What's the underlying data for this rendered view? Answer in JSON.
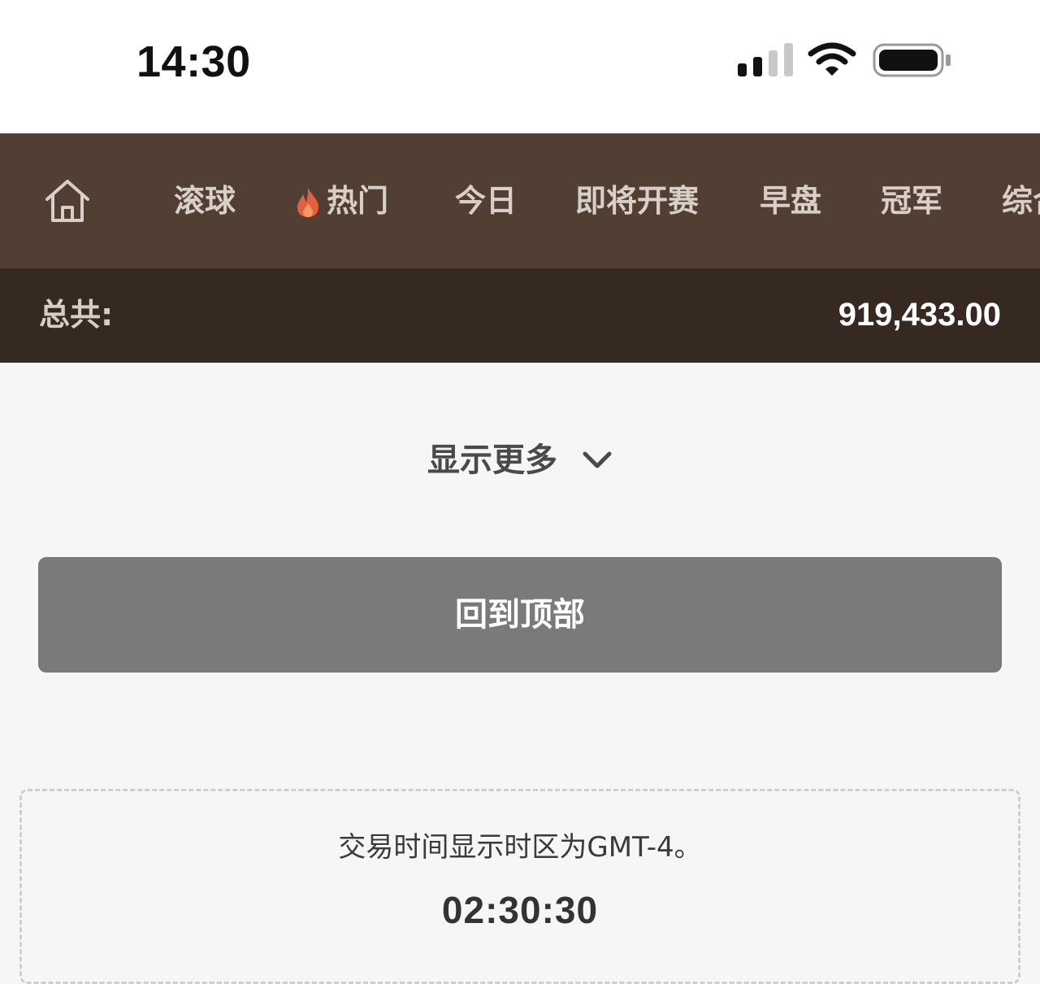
{
  "status_bar": {
    "time": "14:30",
    "icons": [
      "signal-icon",
      "wifi-icon",
      "battery-icon"
    ]
  },
  "nav": {
    "home_icon": "home-icon",
    "tabs": [
      {
        "label": "滚球"
      },
      {
        "label": "热门",
        "icon": "fire-icon"
      },
      {
        "label": "今日"
      },
      {
        "label": "即将开赛"
      },
      {
        "label": "早盘"
      },
      {
        "label": "冠军"
      },
      {
        "label": "综合"
      }
    ]
  },
  "total": {
    "label": "总共:",
    "value": "919,433.00"
  },
  "show_more": {
    "label": "显示更多",
    "icon": "chevron-down-icon"
  },
  "back_to_top": {
    "label": "回到顶部"
  },
  "timezone": {
    "note": "交易时间显示时区为GMT-4。",
    "clock": "02:30:30"
  },
  "colors": {
    "nav_bg": "#523f33",
    "total_bg": "#362922",
    "button_bg": "#7a7a7a",
    "fire": "#e4603c"
  }
}
